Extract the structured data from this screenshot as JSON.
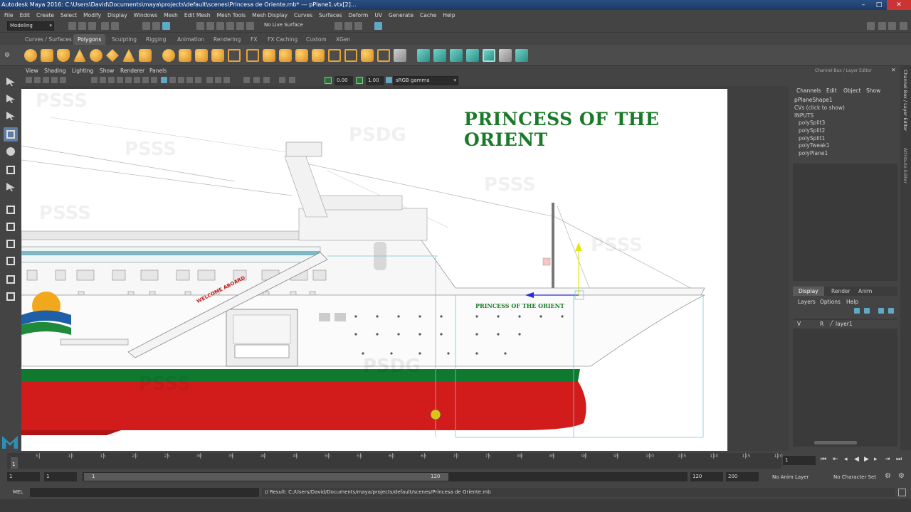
{
  "window": {
    "title": "Autodesk Maya 2016: C:\\Users\\David\\Documents\\maya\\projects\\default\\scenes\\Princesa de Oriente.mb*   ---   pPlane1.vtx[2]..."
  },
  "menubar": [
    "File",
    "Edit",
    "Create",
    "Select",
    "Modify",
    "Display",
    "Windows",
    "Mesh",
    "Edit Mesh",
    "Mesh Tools",
    "Mesh Display",
    "Curves",
    "Surfaces",
    "Deform",
    "UV",
    "Generate",
    "Cache",
    "Help"
  ],
  "statusline": {
    "mode": "Modeling",
    "live_surface": "No Live Surface"
  },
  "shelf_tabs": [
    "Curves / Surfaces",
    "Polygons",
    "Sculpting",
    "Rigging",
    "Animation",
    "Rendering",
    "FX",
    "FX Caching",
    "Custom",
    "XGen"
  ],
  "active_shelf_tab": "Polygons",
  "panel_menu": [
    "View",
    "Shading",
    "Lighting",
    "Show",
    "Renderer",
    "Panels"
  ],
  "panel_toolbar": {
    "value1": "0.00",
    "value2": "1.00",
    "color_space": "sRGB gamma"
  },
  "image_plane": {
    "title": "PRINCESS OF THE ORIENT",
    "hull_name": "PRINCESS OF THE ORIENT",
    "gangway_text": "WELCOME ABOARD",
    "watermarks": [
      "PSSS",
      "PSDG",
      "PSSS",
      "PSSS",
      "PSSS",
      "PSDG",
      "PSSS",
      "PSSS"
    ],
    "colors": {
      "title": "#1a7a2a",
      "hull_green": "#0f7a2f",
      "hull_red": "#d21c1c",
      "hull_white": "#ffffff"
    }
  },
  "channel_box": {
    "header": "Channel Box / Layer Editor",
    "menus": [
      "Channels",
      "Edit",
      "Object",
      "Show"
    ],
    "shape": "pPlaneShape1",
    "hint": "CVs (click to show)",
    "inputs_label": "INPUTS",
    "inputs": [
      "polySplit3",
      "polySplit2",
      "polySplit1",
      "polyTweak1",
      "polyPlane1"
    ]
  },
  "layer_editor": {
    "tabs": [
      "Display",
      "Render",
      "Anim"
    ],
    "active_tab": "Display",
    "menus": [
      "Layers",
      "Options",
      "Help"
    ],
    "layer": {
      "v": "V",
      "r": "R",
      "name": "layer1"
    }
  },
  "side_tabs": [
    "Channel Box / Layer Editor",
    "Attribute Editor"
  ],
  "timeline": {
    "ticks": [
      "5",
      "10",
      "15",
      "20",
      "25",
      "30",
      "35",
      "40",
      "45",
      "50",
      "55",
      "60",
      "65",
      "70",
      "75",
      "80",
      "85",
      "90",
      "95",
      "100",
      "105",
      "110",
      "115",
      "120"
    ],
    "current_frame_label": "1",
    "current_frame": "1"
  },
  "range": {
    "start": "1",
    "start2": "1",
    "slider_start": "1",
    "slider_end": "120",
    "end": "120",
    "end2": "200",
    "anim_layer": "No Anim Layer",
    "char_set": "No Character Set"
  },
  "command_line": {
    "lang": "MEL",
    "result": "// Result: C:/Users/David/Documents/maya/projects/default/scenes/Princesa de Oriente.mb"
  }
}
